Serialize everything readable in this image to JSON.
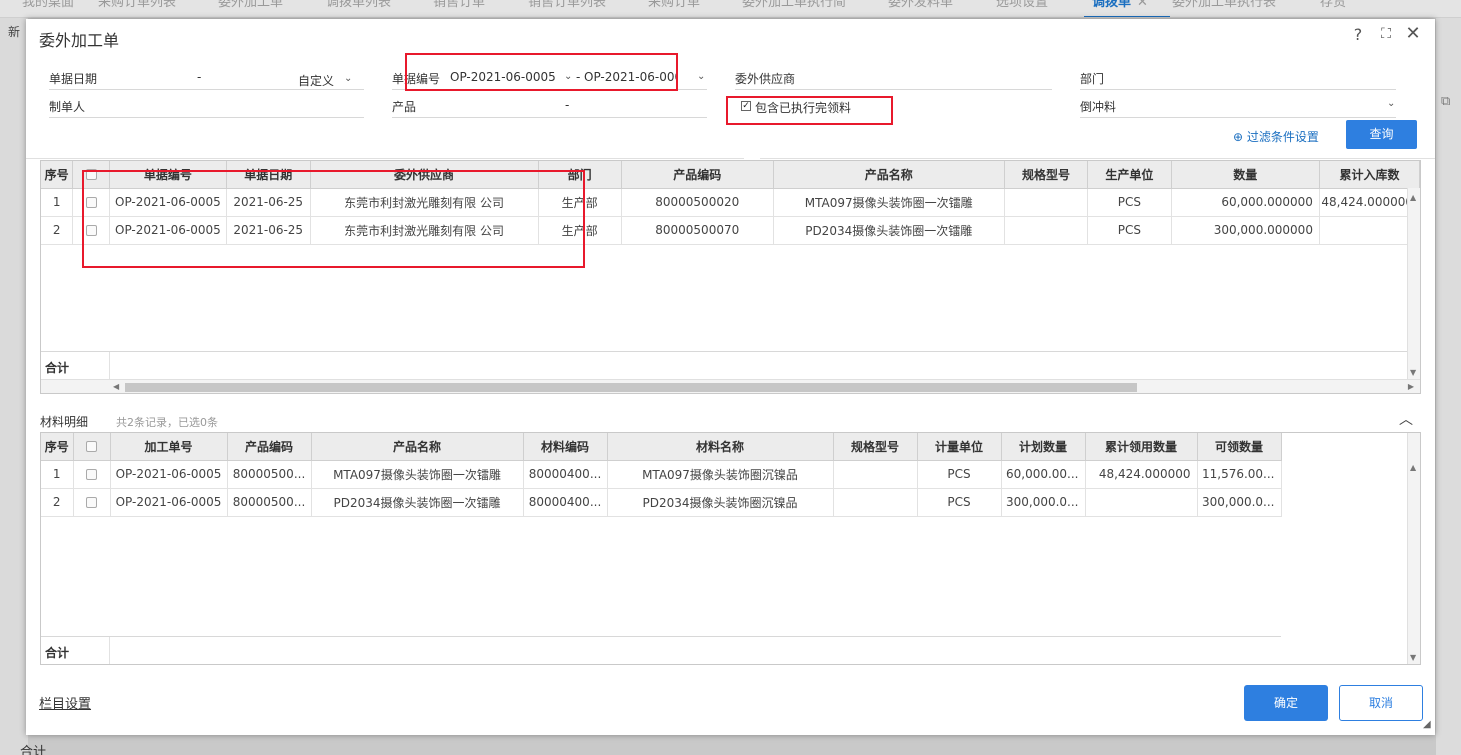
{
  "background": {
    "tabs": [
      "我的桌面",
      "采购订单列表",
      "委外加工单",
      "调拨单列表",
      "销售订单",
      "销售订单列表",
      "采购订单",
      "委外加工单执行简",
      "委外发料单",
      "选项设置",
      "调拨单",
      "委外加工单执行表",
      "存货"
    ],
    "active_tab": "调拨单",
    "toolbar_new": "新",
    "total_label": "合计",
    "right_icon": "layout-icon"
  },
  "dialog": {
    "title": "委外加工单",
    "help_icon": "help-icon",
    "maximize_icon": "maximize-icon",
    "close_icon": "close-icon"
  },
  "filters": {
    "date_label": "单据日期",
    "date_sep": "-",
    "date_mode": "自定义",
    "code_label": "单据编号",
    "code_from": "OP-2021-06-0005",
    "code_sep": "-",
    "code_to": "OP-2021-06-0005",
    "supplier_label": "委外供应商",
    "dept_label": "部门",
    "maker_label": "制单人",
    "product_label": "产品",
    "product_sep": "-",
    "include_executed_label": "包含已执行完领料",
    "include_executed_checked": true,
    "backflush_value": "倒冲料",
    "filter_settings_label": "过滤条件设置",
    "query_label": "查询"
  },
  "orders": {
    "columns": [
      "序号",
      "",
      "单据编号",
      "单据日期",
      "委外供应商",
      "部门",
      "产品编码",
      "产品名称",
      "规格型号",
      "生产单位",
      "数量",
      "累计入库数"
    ],
    "rows": [
      {
        "idx": "1",
        "code": "OP-2021-06-0005",
        "date": "2021-06-25",
        "supplier": "东莞市利封激光雕刻有限 公司",
        "dept": "生产部",
        "prod_code": "80000500020",
        "prod_name": "MTA097摄像头装饰圈一次镭雕",
        "spec": "",
        "unit": "PCS",
        "qty": "60,000.000000",
        "received": "48,424.000000"
      },
      {
        "idx": "2",
        "code": "OP-2021-06-0005",
        "date": "2021-06-25",
        "supplier": "东莞市利封激光雕刻有限 公司",
        "dept": "生产部",
        "prod_code": "80000500070",
        "prod_name": "PD2034摄像头装饰圈一次镭雕",
        "spec": "",
        "unit": "PCS",
        "qty": "300,000.000000",
        "received": ""
      }
    ],
    "total_label": "合计"
  },
  "materials": {
    "title": "材料明细",
    "count_text": "共2条记录，已选0条",
    "columns": [
      "序号",
      "",
      "加工单号",
      "产品编码",
      "产品名称",
      "材料编码",
      "材料名称",
      "规格型号",
      "计量单位",
      "计划数量",
      "累计领用数量",
      "可领数量"
    ],
    "rows": [
      {
        "idx": "1",
        "order": "OP-2021-06-0005",
        "prod_code": "80000500...",
        "prod_name": "MTA097摄像头装饰圈一次镭雕",
        "mat_code": "80000400...",
        "mat_name": "MTA097摄像头装饰圈沉镍品",
        "spec": "",
        "unit": "PCS",
        "plan": "60,000.00...",
        "used": "48,424.000000",
        "avail": "11,576.00..."
      },
      {
        "idx": "2",
        "order": "OP-2021-06-0005",
        "prod_code": "80000500...",
        "prod_name": "PD2034摄像头装饰圈一次镭雕",
        "mat_code": "80000400...",
        "mat_name": "PD2034摄像头装饰圈沉镍品",
        "spec": "",
        "unit": "PCS",
        "plan": "300,000.0...",
        "used": "",
        "avail": "300,000.0..."
      }
    ],
    "total_label": "合计",
    "collapse_icon": "chevron-up-icon"
  },
  "footer": {
    "column_settings": "栏目设置",
    "ok_label": "确定",
    "cancel_label": "取消"
  },
  "colors": {
    "accent": "#2e7fe0",
    "highlight": "#e8192c"
  }
}
